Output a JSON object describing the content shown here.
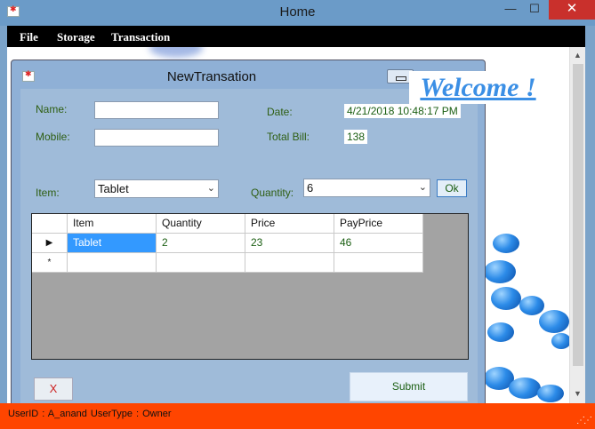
{
  "window": {
    "title": "Home",
    "controls": {
      "minimize": "—",
      "maximize": "☐",
      "close": "✕"
    }
  },
  "menu": [
    "File",
    "Storage",
    "Transaction"
  ],
  "banner": {
    "text": "Welcome !",
    "color": "#3b8fe5"
  },
  "form": {
    "title": "NewTransation",
    "labels": {
      "name": "Name:",
      "mobile": "Mobile:",
      "date": "Date:",
      "total_bill": "Total Bill:",
      "item": "Item:",
      "quantity": "Quantity:"
    },
    "fields": {
      "name": "",
      "mobile": "",
      "date": "4/21/2018 10:48:17 PM",
      "total_bill": "138"
    },
    "item_select": {
      "selected": "Tablet"
    },
    "quantity_select": {
      "selected": "6"
    },
    "ok_label": "Ok",
    "cancel_label": "X",
    "submit_label": "Submit"
  },
  "grid": {
    "columns": [
      "Item",
      "Quantity",
      "Price",
      "PayPrice"
    ],
    "rows": [
      {
        "indicator": "▶",
        "cells": [
          "Tablet",
          "2",
          "23",
          "46"
        ]
      },
      {
        "indicator": "*",
        "cells": [
          "",
          "",
          "",
          ""
        ]
      }
    ]
  },
  "status": {
    "text": "UserID :  A_anand   UserType :  Owner",
    "color": "#ff4500"
  },
  "icons": [
    "app-icon",
    "minimize-icon",
    "maximize-icon",
    "close-icon",
    "resize-grip-icon",
    "dropdown-arrow-icon"
  ]
}
